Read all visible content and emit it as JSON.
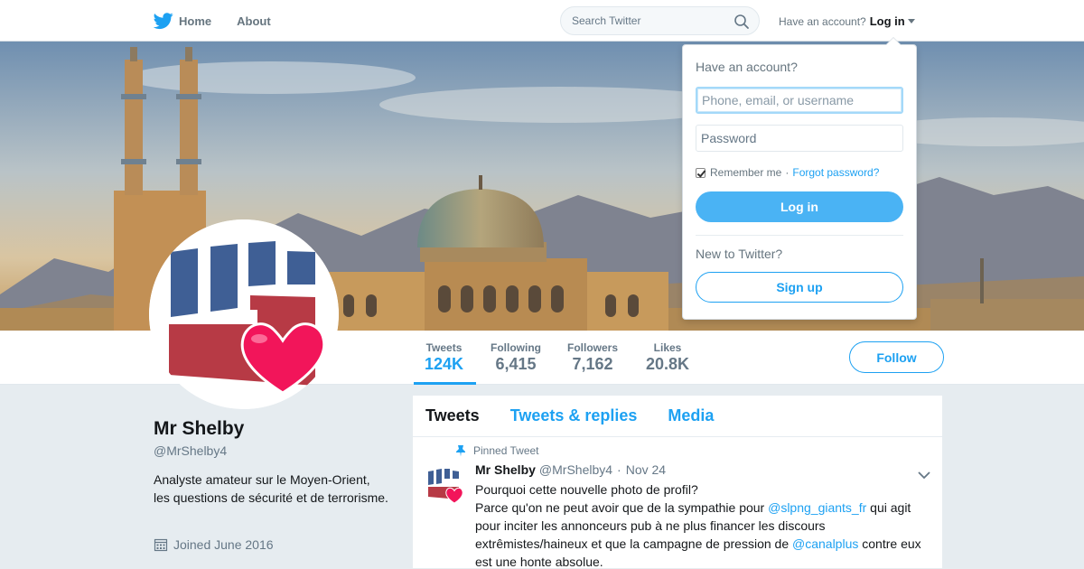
{
  "nav": {
    "home_label": "Home",
    "about_label": "About",
    "search_placeholder": "Search Twitter",
    "have_account": "Have an account?",
    "login_label": "Log in"
  },
  "profile": {
    "name": "Mr Shelby",
    "handle": "@MrShelby4",
    "bio": "Analyste amateur sur le Moyen-Orient, les questions de sécurité et de terrorisme.",
    "joined": "Joined June 2016"
  },
  "stats": [
    {
      "label": "Tweets",
      "value": "124K"
    },
    {
      "label": "Following",
      "value": "6,415"
    },
    {
      "label": "Followers",
      "value": "7,162"
    },
    {
      "label": "Likes",
      "value": "20.8K"
    }
  ],
  "follow_label": "Follow",
  "tabs": [
    "Tweets",
    "Tweets & replies",
    "Media"
  ],
  "pinned_tweet": {
    "pinned_label": "Pinned Tweet",
    "author_name": "Mr Shelby",
    "author_handle": "@MrShelby4",
    "separator": "·",
    "date": "Nov 24",
    "text_line1": "Pourquoi cette nouvelle photo de profil?",
    "text_part_a": "Parce qu'on ne peut avoir que de la sympathie pour ",
    "mention_a": "@slpng_giants_fr",
    "text_part_b": " qui agit pour inciter les annonceurs pub à ne plus financer les discours extrêmistes/haineux et que la campagne de pression de ",
    "mention_b": "@canalplus",
    "text_part_c": " contre eux est une honte absolue."
  },
  "login_dropdown": {
    "title": "Have an account?",
    "username_placeholder": "Phone, email, or username",
    "password_placeholder": "Password",
    "remember_label": "Remember me",
    "separator": "·",
    "forgot_label": "Forgot password?",
    "login_button": "Log in",
    "new_label": "New to Twitter?",
    "signup_button": "Sign up"
  },
  "colors": {
    "accent": "#1da1f2",
    "login_button": "#4ab3f4",
    "background": "#e6ecf0"
  }
}
